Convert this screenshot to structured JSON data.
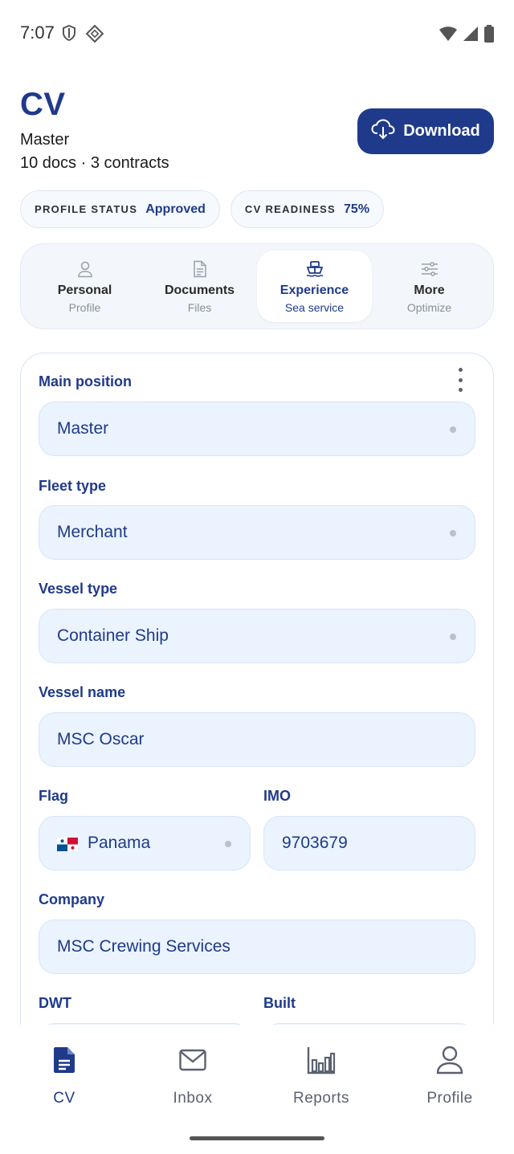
{
  "status_bar": {
    "time": "7:07"
  },
  "header": {
    "title": "CV",
    "subtitle": "Master",
    "meta": "10 docs · 3 contracts",
    "download_label": "Download"
  },
  "chips": [
    {
      "label": "PROFILE STATUS",
      "value": "Approved"
    },
    {
      "label": "CV READINESS",
      "value": "75%"
    }
  ],
  "tabs": [
    {
      "label": "Personal",
      "sub": "Profile",
      "icon": "person-icon",
      "active": false
    },
    {
      "label": "Documents",
      "sub": "Files",
      "icon": "document-icon",
      "active": false
    },
    {
      "label": "Experience",
      "sub": "Sea service",
      "icon": "ship-icon",
      "active": true
    },
    {
      "label": "More",
      "sub": "Optimize",
      "icon": "sliders-icon",
      "active": false
    }
  ],
  "form": {
    "main_position": {
      "label": "Main position",
      "value": "Master"
    },
    "fleet_type": {
      "label": "Fleet type",
      "value": "Merchant"
    },
    "vessel_type": {
      "label": "Vessel type",
      "value": "Container Ship"
    },
    "vessel_name": {
      "label": "Vessel name",
      "value": "MSC Oscar"
    },
    "flag": {
      "label": "Flag",
      "value": "Panama"
    },
    "imo": {
      "label": "IMO",
      "value": "9703679"
    },
    "company": {
      "label": "Company",
      "value": "MSC Crewing Services"
    },
    "dwt": {
      "label": "DWT"
    },
    "built": {
      "label": "Built"
    }
  },
  "bottom_nav": [
    {
      "label": "CV",
      "icon": "cv-document-icon",
      "active": true
    },
    {
      "label": "Inbox",
      "icon": "mail-icon",
      "active": false
    },
    {
      "label": "Reports",
      "icon": "bar-chart-icon",
      "active": false
    },
    {
      "label": "Profile",
      "icon": "person-icon",
      "active": false
    }
  ],
  "colors": {
    "primary": "#1f3a8a",
    "field_bg": "#eaf3fe",
    "muted": "#8a8f99"
  }
}
